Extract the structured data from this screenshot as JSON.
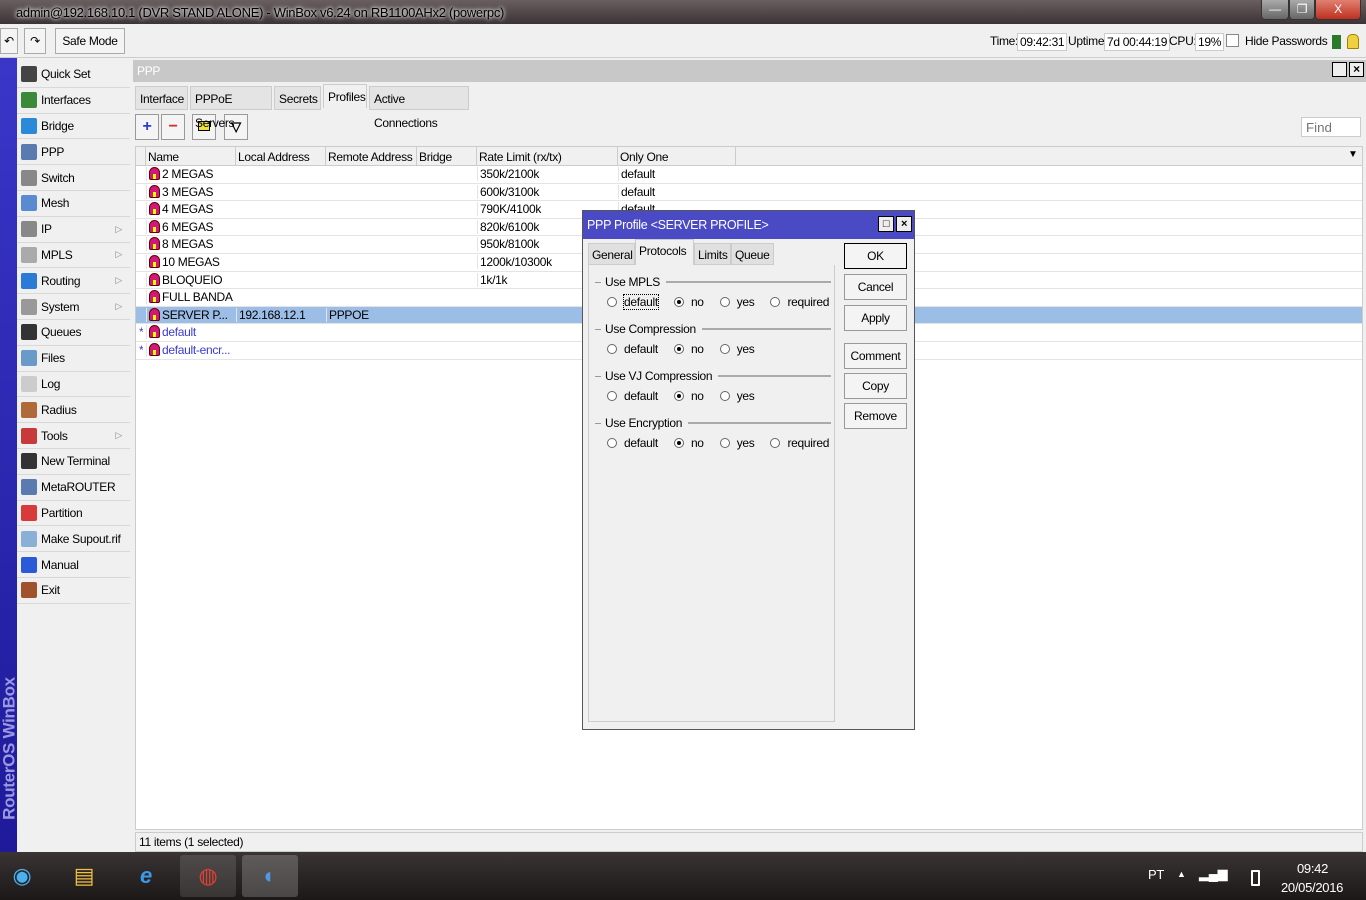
{
  "window": {
    "title": "admin@192.168.10.1 (DVR STAND ALONE) - WinBox v6.24 on RB1100AHx2 (powerpc)",
    "minimize": "—",
    "restore": "❐",
    "close": "X"
  },
  "toolbar": {
    "undo": "↶",
    "redo": "↷",
    "safe_mode": "Safe Mode",
    "time_label": "Time:",
    "time": "09:42:31",
    "uptime_label": "Uptime:",
    "uptime": "7d 00:44:19",
    "cpu_label": "CPU:",
    "cpu": "19%",
    "hide_passwords": "Hide Passwords"
  },
  "brand": "RouterOS WinBox",
  "sidebar": {
    "items": [
      {
        "label": "Quick Set",
        "icon": "wand-icon",
        "color": "#444",
        "sub": false
      },
      {
        "label": "Interfaces",
        "icon": "nic-icon",
        "color": "#3a8a3a",
        "sub": false
      },
      {
        "label": "Bridge",
        "icon": "bridge-icon",
        "color": "#2a8ad8",
        "sub": false
      },
      {
        "label": "PPP",
        "icon": "ppp-icon",
        "color": "#5a7ab0",
        "sub": false
      },
      {
        "label": "Switch",
        "icon": "switch-icon",
        "color": "#888",
        "sub": false
      },
      {
        "label": "Mesh",
        "icon": "mesh-icon",
        "color": "#5a8ad0",
        "sub": false
      },
      {
        "label": "IP",
        "icon": "ip-icon",
        "color": "#888",
        "sub": true
      },
      {
        "label": "MPLS",
        "icon": "mpls-icon",
        "color": "#aaa",
        "sub": true
      },
      {
        "label": "Routing",
        "icon": "routing-icon",
        "color": "#2a7ad8",
        "sub": true
      },
      {
        "label": "System",
        "icon": "gear-icon",
        "color": "#999",
        "sub": true
      },
      {
        "label": "Queues",
        "icon": "gauge-icon",
        "color": "#333",
        "sub": false
      },
      {
        "label": "Files",
        "icon": "folder-icon",
        "color": "#6a9ac8",
        "sub": false
      },
      {
        "label": "Log",
        "icon": "log-icon",
        "color": "#ccc",
        "sub": false
      },
      {
        "label": "Radius",
        "icon": "users-icon",
        "color": "#b06a3a",
        "sub": false
      },
      {
        "label": "Tools",
        "icon": "tools-icon",
        "color": "#c83a3a",
        "sub": true
      },
      {
        "label": "New Terminal",
        "icon": "terminal-icon",
        "color": "#333",
        "sub": false
      },
      {
        "label": "MetaROUTER",
        "icon": "metarouter-icon",
        "color": "#5a7ab0",
        "sub": false
      },
      {
        "label": "Partition",
        "icon": "partition-icon",
        "color": "#d83a3a",
        "sub": false
      },
      {
        "label": "Make Supout.rif",
        "icon": "file-icon",
        "color": "#8ab0d8",
        "sub": false
      },
      {
        "label": "Manual",
        "icon": "help-icon",
        "color": "#2a5ad8",
        "sub": false
      },
      {
        "label": "Exit",
        "icon": "door-icon",
        "color": "#a0522d",
        "sub": false
      }
    ]
  },
  "ppp": {
    "title": "PPP",
    "tabs": [
      "Interface",
      "PPPoE Servers",
      "Secrets",
      "Profiles",
      "Active Connections"
    ],
    "active_tab": "Profiles",
    "add": "+",
    "remove": "−",
    "find_placeholder": "Find",
    "columns": [
      "Name",
      "Local Address",
      "Remote Address",
      "Bridge",
      "Rate Limit (rx/tx)",
      "Only One"
    ],
    "rows": [
      {
        "mark": "",
        "name": "2 MEGAS",
        "local": "",
        "remote": "",
        "bridge": "",
        "rate": "350k/2100k",
        "only_one": "default"
      },
      {
        "mark": "",
        "name": "3 MEGAS",
        "local": "",
        "remote": "",
        "bridge": "",
        "rate": "600k/3100k",
        "only_one": "default"
      },
      {
        "mark": "",
        "name": "4 MEGAS",
        "local": "",
        "remote": "",
        "bridge": "",
        "rate": "790K/4100k",
        "only_one": "default"
      },
      {
        "mark": "",
        "name": "6 MEGAS",
        "local": "",
        "remote": "",
        "bridge": "",
        "rate": "820k/6100k",
        "only_one": ""
      },
      {
        "mark": "",
        "name": "8 MEGAS",
        "local": "",
        "remote": "",
        "bridge": "",
        "rate": "950k/8100k",
        "only_one": ""
      },
      {
        "mark": "",
        "name": "10 MEGAS",
        "local": "",
        "remote": "",
        "bridge": "",
        "rate": "1200k/10300k",
        "only_one": ""
      },
      {
        "mark": "",
        "name": "BLOQUEIO",
        "local": "",
        "remote": "",
        "bridge": "",
        "rate": "1k/1k",
        "only_one": ""
      },
      {
        "mark": "",
        "name": "FULL BANDA",
        "local": "",
        "remote": "",
        "bridge": "",
        "rate": "",
        "only_one": ""
      },
      {
        "mark": "",
        "name": "SERVER P...",
        "local": "192.168.12.1",
        "remote": "PPPOE",
        "bridge": "",
        "rate": "",
        "only_one": "",
        "selected": true
      },
      {
        "mark": "*",
        "name": "default",
        "local": "",
        "remote": "",
        "bridge": "",
        "rate": "",
        "only_one": "",
        "dynamic": true
      },
      {
        "mark": "*",
        "name": "default-encr...",
        "local": "",
        "remote": "",
        "bridge": "",
        "rate": "",
        "only_one": "",
        "dynamic": true
      }
    ],
    "status": "11 items (1 selected)"
  },
  "dialog": {
    "title": "PPP Profile <SERVER PROFILE>",
    "tabs": [
      "General",
      "Protocols",
      "Limits",
      "Queue"
    ],
    "active_tab": "Protocols",
    "groups": [
      {
        "label": "Use MPLS",
        "options": [
          "default",
          "no",
          "yes",
          "required"
        ],
        "selected": "no"
      },
      {
        "label": "Use Compression",
        "options": [
          "default",
          "no",
          "yes"
        ],
        "selected": "no"
      },
      {
        "label": "Use VJ Compression",
        "options": [
          "default",
          "no",
          "yes"
        ],
        "selected": "no"
      },
      {
        "label": "Use Encryption",
        "options": [
          "default",
          "no",
          "yes",
          "required"
        ],
        "selected": "no"
      }
    ],
    "buttons": [
      "OK",
      "Cancel",
      "Apply",
      "Comment",
      "Copy",
      "Remove"
    ]
  },
  "taskbar": {
    "lang": "PT",
    "time": "09:42",
    "date": "20/05/2016"
  }
}
